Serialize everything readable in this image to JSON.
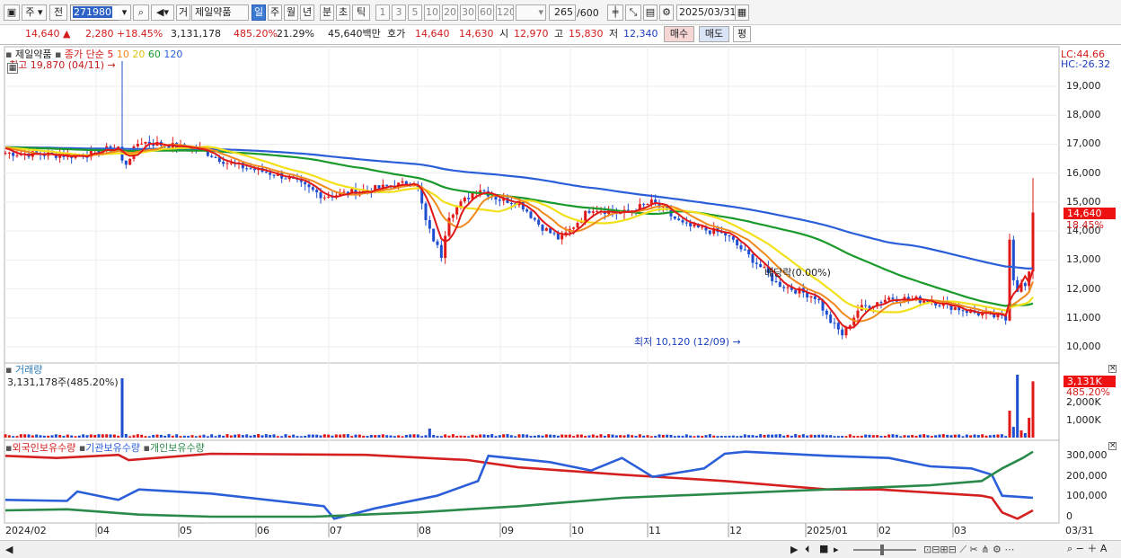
{
  "toolbar": {
    "type_btn": "주",
    "prev_btn": "전",
    "code": "271980",
    "name_label": "거",
    "stock_name": "제일약품",
    "periods": [
      "일",
      "주",
      "월",
      "년",
      "분",
      "초",
      "틱"
    ],
    "ticks": [
      "1",
      "3",
      "5",
      "10",
      "20",
      "30",
      "60",
      "120"
    ],
    "count": "265",
    "count_max": "/600",
    "date": "2025/03/31"
  },
  "infobar": {
    "price": "14,640",
    "change": "2,280",
    "change_pct": "+18.45%",
    "volume": "3,131,178",
    "vol_pct": "485.20%",
    "turnover": "21.29%",
    "amount": "45,640백만",
    "bid_label": "호가",
    "bid": "14,640",
    "ask": "14,630",
    "open_label": "시",
    "open": "12,970",
    "high_label": "고",
    "high": "15,830",
    "low_label": "저",
    "low": "12,340",
    "buy": "매수",
    "sell": "매도",
    "eval": "평"
  },
  "price_panel": {
    "legend_name": "제일약품",
    "legend_ma": "종가 단순",
    "ma_periods": [
      "5",
      "10",
      "20",
      "60",
      "120"
    ],
    "high_mark": "최고 19,870 (04/11)",
    "low_mark": "최저 10,120 (12/09)",
    "dividend_mark": "배당락(0.00%)",
    "lc": "LC:44.66",
    "hc": "HC:-26.32",
    "price_tag": "14,640",
    "pct_tag": "18.45%",
    "y_ticks": [
      "19,000",
      "18,000",
      "17,000",
      "16,000",
      "15,000",
      "14,000",
      "13,000",
      "12,000",
      "11,000",
      "10,000"
    ]
  },
  "volume_panel": {
    "title": "거래량",
    "value": "3,131,178주(485.20%)",
    "tag": "3,131K",
    "tag_pct": "485.20%",
    "y_ticks": [
      "2,000K",
      "1,000K"
    ]
  },
  "holdings_panel": {
    "legend": [
      "외국인보유수량",
      "기관보유수량",
      "개인보유수량"
    ],
    "y_ticks": [
      "300,000",
      "200,000",
      "100,000",
      "0"
    ]
  },
  "x_axis": [
    "2024/02",
    "04",
    "05",
    "06",
    "07",
    "08",
    "09",
    "10",
    "11",
    "12",
    "2025/01",
    "02",
    "03",
    "03/31"
  ],
  "colors": {
    "ma5": "#e01818",
    "ma10": "#f08a1c",
    "ma20": "#f2e01a",
    "ma60": "#1a9a2a",
    "ma120": "#2b5fd9",
    "up": "#e01818",
    "down": "#1f4fd0"
  }
}
